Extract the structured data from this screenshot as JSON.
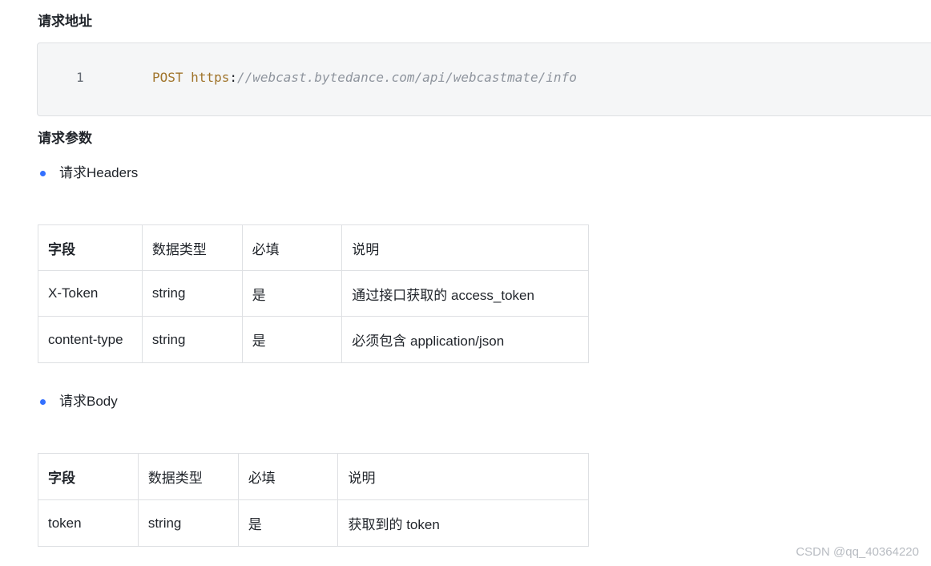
{
  "sections": {
    "address_heading": "请求地址",
    "params_heading": "请求参数"
  },
  "code_block": {
    "line_number": "1",
    "method": "POST",
    "protocol": "https",
    "colon": ":",
    "path": "//webcast.bytedance.com/api/webcastmate/info"
  },
  "headers_section": {
    "bullet_label": "请求Headers",
    "columns": [
      "字段",
      "数据类型",
      "必填",
      "说明"
    ],
    "rows": [
      [
        "X-Token",
        "string",
        "是",
        "通过接口获取的 access_token"
      ],
      [
        "content-type",
        "string",
        "是",
        "必须包含 application/json"
      ]
    ]
  },
  "body_section": {
    "bullet_label": "请求Body",
    "columns": [
      "字段",
      "数据类型",
      "必填",
      "说明"
    ],
    "rows": [
      [
        "token",
        "string",
        "是",
        "获取到的 token"
      ]
    ]
  },
  "watermark": "CSDN @qq_40364220",
  "colors": {
    "bullet": "#3370ff",
    "keyword": "#a0742b",
    "url": "#8f959e",
    "code_bg": "#f5f6f7",
    "border": "#dee0e3"
  }
}
